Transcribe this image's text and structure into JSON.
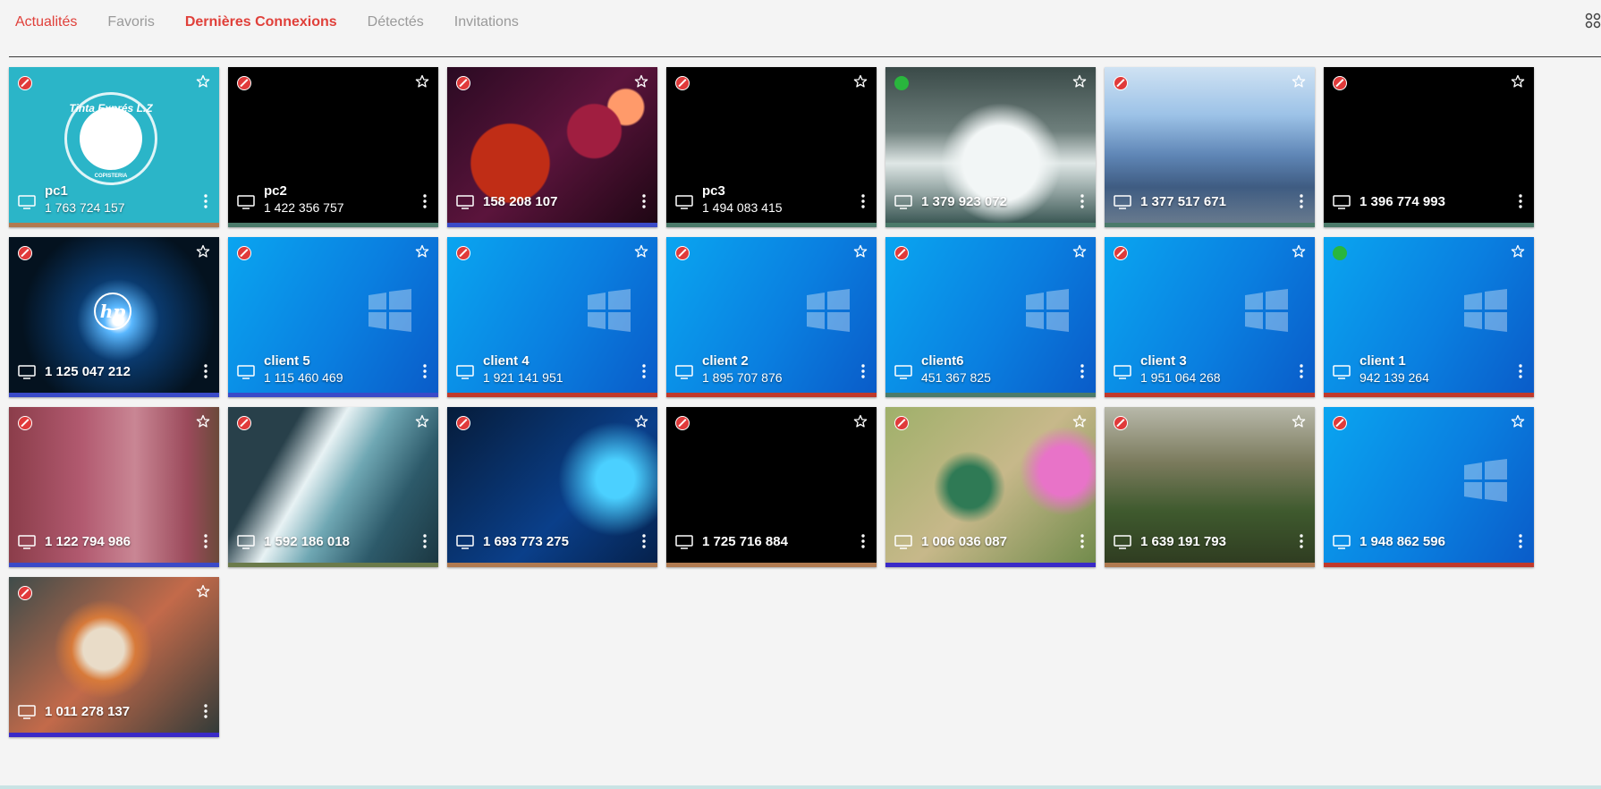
{
  "tabs": [
    {
      "label": "Actualités",
      "state": "link"
    },
    {
      "label": "Favoris",
      "state": "inactive"
    },
    {
      "label": "Dernières Connexions",
      "state": "active"
    },
    {
      "label": "Détectés",
      "state": "inactive"
    },
    {
      "label": "Invitations",
      "state": "inactive"
    }
  ],
  "logo_text": {
    "top": "Tinta Exprés L.Z",
    "bottom": "COPISTERIA"
  },
  "hp_text": "hp",
  "devices": [
    {
      "name": "pc1",
      "id": "1 763 724 157",
      "status": "blocked",
      "bg": "teal",
      "strip": "#b07a50"
    },
    {
      "name": "pc2",
      "id": "1 422 356 757",
      "status": "blocked",
      "bg": "black",
      "strip": "#4b7a6a"
    },
    {
      "name": "",
      "id": "158 208 107",
      "status": "blocked",
      "bg": "abstract",
      "strip": "#3a4ac8"
    },
    {
      "name": "pc3",
      "id": "1 494 083 415",
      "status": "blocked",
      "bg": "black",
      "strip": "#4b7a6a"
    },
    {
      "name": "",
      "id": "1 379 923 072",
      "status": "online",
      "bg": "water",
      "strip": "#4b7a6a"
    },
    {
      "name": "",
      "id": "1 377 517 671",
      "status": "blocked",
      "bg": "mountain",
      "strip": "#4b7a6a"
    },
    {
      "name": "",
      "id": "1 396 774 993",
      "status": "blocked",
      "bg": "black",
      "strip": "#4b7a6a"
    },
    {
      "name": "",
      "id": "1 125 047 212",
      "status": "blocked",
      "bg": "hp",
      "strip": "#3a4ac8"
    },
    {
      "name": "client 5",
      "id": "1 115 460 469",
      "status": "blocked",
      "bg": "win",
      "strip": "#3a4ac8"
    },
    {
      "name": "client 4",
      "id": "1 921 141 951",
      "status": "blocked",
      "bg": "win",
      "strip": "#c0392b"
    },
    {
      "name": "client 2",
      "id": "1 895 707 876",
      "status": "blocked",
      "bg": "win",
      "strip": "#c0392b"
    },
    {
      "name": "client6",
      "id": "451 367 825",
      "status": "blocked",
      "bg": "win",
      "strip": "#4b7a6a"
    },
    {
      "name": "client 3",
      "id": "1 951 064 268",
      "status": "blocked",
      "bg": "win",
      "strip": "#c0392b"
    },
    {
      "name": "client 1",
      "id": "942 139 264",
      "status": "online",
      "bg": "win",
      "strip": "#c0392b"
    },
    {
      "name": "",
      "id": "1 122 794 986",
      "status": "blocked",
      "bg": "canyon",
      "strip": "#3a4ac8"
    },
    {
      "name": "",
      "id": "1 592 186 018",
      "status": "blocked",
      "bg": "wave",
      "strip": "#6b7a4a"
    },
    {
      "name": "",
      "id": "1 693 773 275",
      "status": "blocked",
      "bg": "win2",
      "strip": "#b07a50"
    },
    {
      "name": "",
      "id": "1 725 716 884",
      "status": "blocked",
      "bg": "black",
      "strip": "#b07a50"
    },
    {
      "name": "",
      "id": "1 006 036 087",
      "status": "blocked",
      "bg": "bird",
      "strip": "#3a2ac8"
    },
    {
      "name": "",
      "id": "1 639 191 793",
      "status": "blocked",
      "bg": "valley",
      "strip": "#b07a50"
    },
    {
      "name": "",
      "id": "1 948 862 596",
      "status": "blocked",
      "bg": "win",
      "strip": "#c0392b"
    },
    {
      "name": "",
      "id": "1 011 278 137",
      "status": "blocked",
      "bg": "tiger",
      "strip": "#3a2ac8"
    }
  ],
  "colors": {
    "accent": "#e0403a",
    "inactive": "#9a9a9a",
    "blocked": "#e03a3a",
    "online": "#29b63d"
  }
}
